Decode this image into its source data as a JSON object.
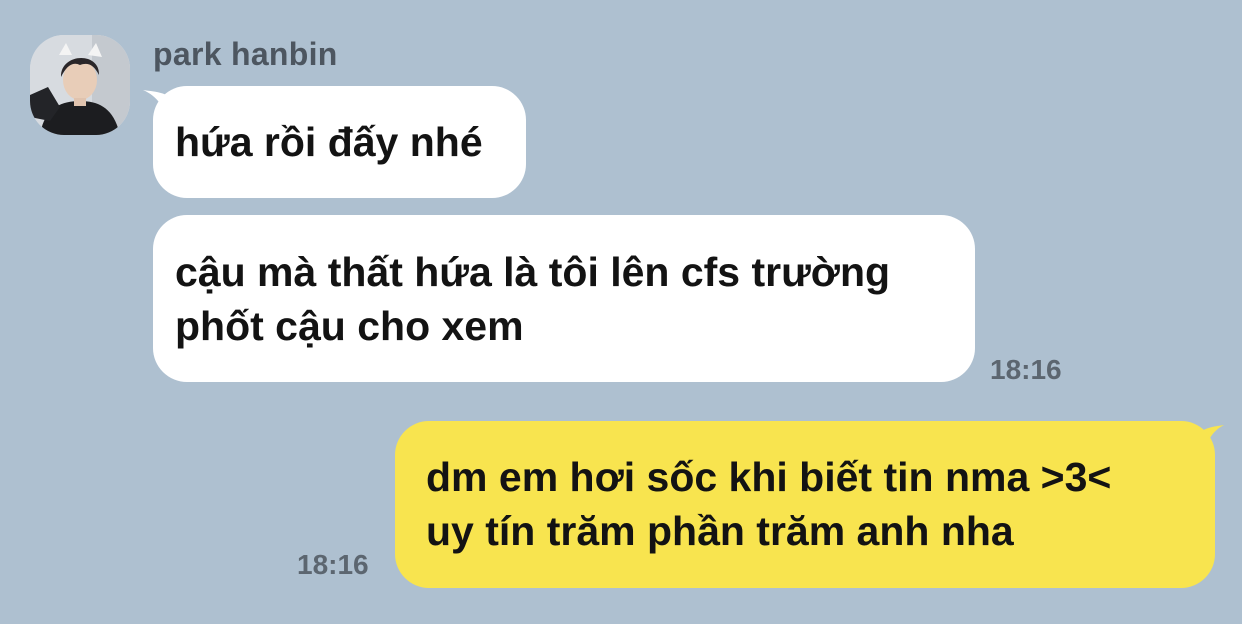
{
  "conversation": {
    "contact_name": "park hanbin",
    "avatar_icon": "profile-photo-avatar",
    "colors": {
      "background": "#aec0d0",
      "incoming_bubble": "#ffffff",
      "outgoing_bubble": "#f8e44f"
    },
    "messages": [
      {
        "direction": "incoming",
        "lines": [
          "hứa rồi đấy nhé"
        ]
      },
      {
        "direction": "incoming",
        "lines": [
          "cậu mà thất hứa là tôi lên cfs trường",
          "phốt cậu cho xem"
        ],
        "time": "18:16"
      },
      {
        "direction": "outgoing",
        "lines": [
          "dm em hơi sốc khi biết tin nma >3<",
          "uy tín trăm phần trăm anh nha"
        ],
        "time": "18:16"
      }
    ]
  }
}
